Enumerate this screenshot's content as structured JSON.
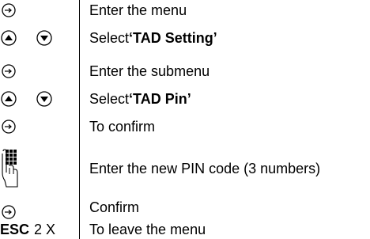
{
  "steps": [
    {
      "icon": "ok-key-icon",
      "text": "Enter the menu"
    },
    {
      "icon": "up-down-keys-icon",
      "text_prefix": "Select ",
      "text_bold": "‘TAD Setting’"
    },
    {
      "icon": "ok-key-icon",
      "text": "Enter the submenu"
    },
    {
      "icon": "up-down-keys-icon",
      "text_prefix": "Select ",
      "text_bold": "‘TAD Pin’"
    },
    {
      "icon": "ok-key-icon",
      "text": "To confirm"
    },
    {
      "icon": "keypad-hand-icon",
      "text": "Enter the new PIN code (3 numbers)"
    },
    {
      "icon": "ok-key-icon",
      "text": "Confirm"
    },
    {
      "icon": "esc-key",
      "key_label": "ESC",
      "key_count": "2 X",
      "text": "To leave the menu"
    }
  ]
}
